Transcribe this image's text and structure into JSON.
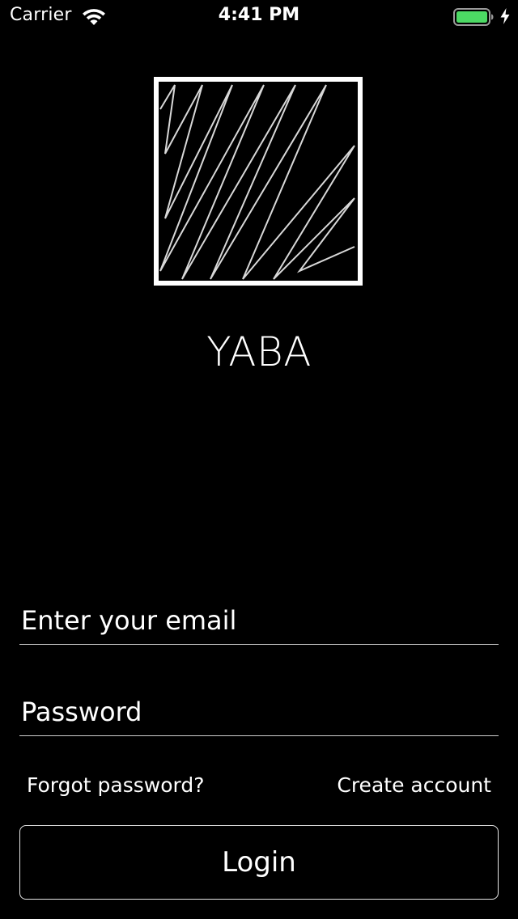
{
  "status_bar": {
    "carrier": "Carrier",
    "time": "4:41 PM",
    "battery_color": "#4cd964",
    "icons": [
      "wifi-icon",
      "battery-icon",
      "charging-icon"
    ]
  },
  "logo": {
    "icon": "yaba-logo-icon",
    "app_name": "YABA"
  },
  "form": {
    "email_placeholder": "Enter your email",
    "password_placeholder": "Password",
    "forgot_password_label": "Forgot password?",
    "create_account_label": "Create account",
    "login_label": "Login"
  },
  "colors": {
    "background": "#000000",
    "foreground": "#ffffff"
  }
}
